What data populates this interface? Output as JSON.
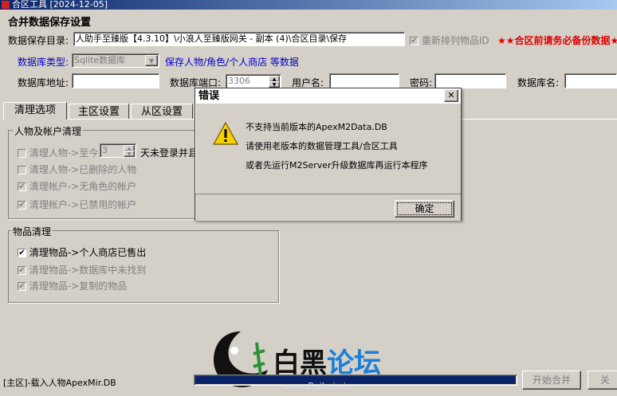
{
  "window": {
    "title": "合区工具 [2024-12-05]"
  },
  "header": {
    "section_title": "合并数据保存设置",
    "save_dir_label": "数据保存目录:",
    "save_dir_value": "人助手至臻版【4.3.10】\\小浪人至臻版网关 - 副本 (4)\\合区目录\\保存",
    "reorder_items_label": "重新排列物品ID",
    "reorder_items_checked": true,
    "backup_warning": "★★合区前请务必备份数据★"
  },
  "database": {
    "type_label": "数据库类型:",
    "type_value": "Sqlite数据库",
    "type_note": "保存人物/角色/个人商店 等数据",
    "address_label": "数据库地址:",
    "address_value": "",
    "port_label": "数据库端口:",
    "port_value": "3306",
    "username_label": "用户名:",
    "username_value": "",
    "password_label": "密码:",
    "password_value": "",
    "dbname_label": "数据库名:",
    "dbname_value": ""
  },
  "tabs": [
    {
      "label": "清理选项",
      "active": true
    },
    {
      "label": "主区设置",
      "active": false
    },
    {
      "label": "从区设置",
      "active": false
    }
  ],
  "character_cleanup": {
    "title": "人物及帐户清理",
    "items": [
      {
        "label": "清理人物->至今",
        "checked": false,
        "enabled": false,
        "days_value": "3",
        "suffix": "天未登录并且"
      },
      {
        "label": "清理人物->已删除的人物",
        "checked": false,
        "enabled": false
      },
      {
        "label": "清理帐户->无角色的帐户",
        "checked": true,
        "enabled": false
      },
      {
        "label": "清理帐户->已禁用的帐户",
        "checked": true,
        "enabled": false
      }
    ]
  },
  "item_cleanup": {
    "title": "物品清理",
    "items": [
      {
        "label": "清理物品->个人商店已售出",
        "checked": true,
        "enabled": true
      },
      {
        "label": "清理物品->数据库中未找到",
        "checked": true,
        "enabled": false
      },
      {
        "label": "清理物品->复制的物品",
        "checked": true,
        "enabled": false
      }
    ]
  },
  "status_bar": {
    "text": "[主区]-载入人物ApexMir.DB",
    "progress_fraction": 1.0,
    "start_button": "开始合并",
    "close_button": "关"
  },
  "dialog": {
    "title": "错误",
    "close_glyph": "✕",
    "icon": "warning-icon",
    "lines": [
      "不支持当前版本的ApexM2Data.DB",
      "请使用老版本的数据管理工具/合区工具",
      "或者先运行M2Server升级数据库再运行本程序"
    ],
    "ok_button": "确定"
  },
  "watermark": {
    "brand_black": "白黑",
    "brand_blue": "论坛",
    "url": "www.Baihei.vip"
  },
  "colors": {
    "window_bg": "#d4d0c8",
    "progress": "#0a246a",
    "label_blue": "#0000c8",
    "warning_red": "#e00000",
    "logo_blue": "#1a7fd9"
  }
}
